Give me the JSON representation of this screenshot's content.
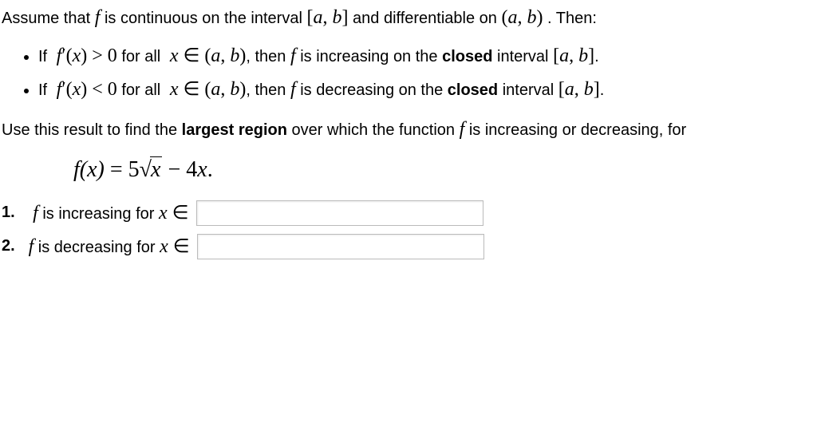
{
  "intro": {
    "pre": "Assume that ",
    "f": "f",
    "mid1": " is continuous on the interval ",
    "closed_ab": "[a, b]",
    "mid2": " and differentiable on ",
    "open_ab": "(a, b)",
    "post": ". Then:"
  },
  "bullets": [
    {
      "if": "If ",
      "cond": "f′(x) > 0",
      "forall": " for all ",
      "xin": "x ∈ (a, b)",
      "then_pre": ", then ",
      "f": "f",
      "then_mid": " is increasing on the ",
      "closed_word": "closed",
      "then_post": " interval ",
      "closed_ab": "[a, b]",
      "dot": "."
    },
    {
      "if": "If ",
      "cond": "f′(x) < 0",
      "forall": " for all ",
      "xin": "x ∈ (a, b)",
      "then_pre": ", then ",
      "f": "f",
      "then_mid": " is decreasing on the ",
      "closed_word": "closed",
      "then_post": " interval ",
      "closed_ab": "[a, b]",
      "dot": "."
    }
  ],
  "prompt": {
    "pre": "Use this result to find the ",
    "largest": "largest region",
    "mid": " over which the function ",
    "f": "f",
    "post": " is increasing or decreasing, for"
  },
  "equation": {
    "lhs": "f(x) = 5",
    "sqrt_sym": "√",
    "sqrt_arg": "x",
    "rhs": " − 4x.",
    "full": "f(x) = 5√x − 4x."
  },
  "questions": [
    {
      "num": "1.",
      "f": "f",
      "text": " is increasing for ",
      "xin": "x ∈",
      "value": ""
    },
    {
      "num": "2.",
      "f": "f",
      "text": " is decreasing for ",
      "xin": "x ∈",
      "value": ""
    }
  ]
}
